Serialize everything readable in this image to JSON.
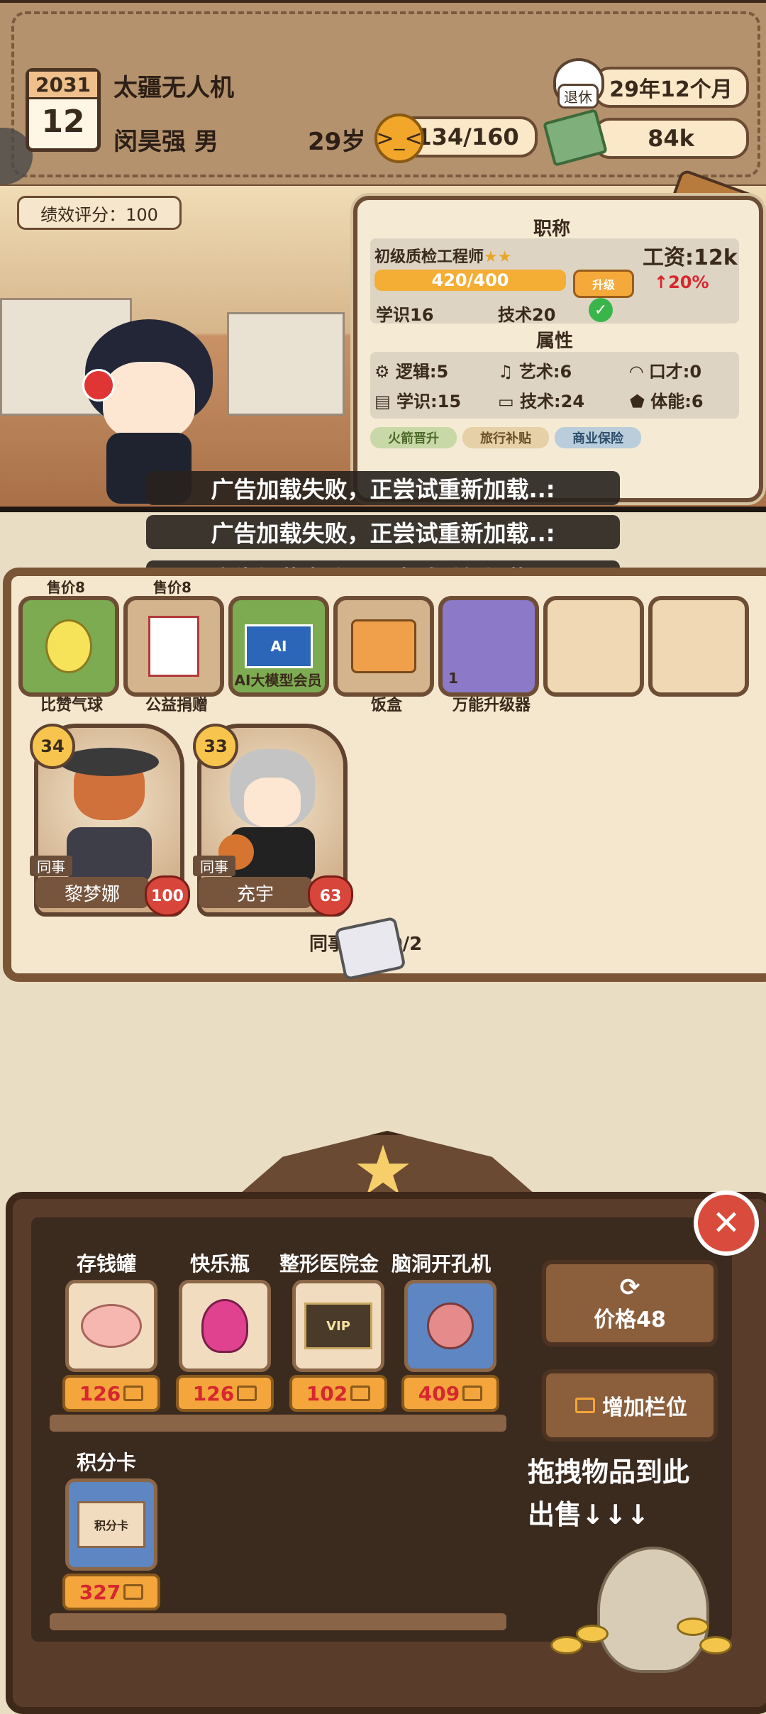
{
  "header": {
    "calendar_year": "2031",
    "calendar_month": "12",
    "company": "太疆无人机",
    "player_name": "闵昊强 男",
    "age": "29岁",
    "energy": "134/160",
    "retire_label": "退休",
    "retire_countdown": "29年12个月",
    "money": "84k"
  },
  "scene": {
    "performance_score": "绩效评分：100"
  },
  "job_panel": {
    "title_section": "职称",
    "job_title": "初级质检工程师",
    "job_stars": "★★",
    "salary": "工资:12k",
    "xp": "420/400",
    "upgrade_label": "升级",
    "boost": "↑20%",
    "req_knowledge": "学识16",
    "req_tech": "技术20",
    "attr_section": "属性",
    "attrs": [
      {
        "icon": "brain-icon",
        "label": "逻辑:5"
      },
      {
        "icon": "music-note-icon",
        "label": "艺术:6"
      },
      {
        "icon": "lips-icon",
        "label": "口才:0"
      },
      {
        "icon": "book-icon",
        "label": "学识:15"
      },
      {
        "icon": "monitor-icon",
        "label": "技术:24"
      },
      {
        "icon": "shield-icon",
        "label": "体能:6"
      }
    ],
    "chips": [
      "火箭晋升",
      "旅行补贴",
      "商业保险"
    ]
  },
  "toasts": [
    "广告加载失败，正尝试重新加载..:",
    "广告加载失败，正尝试重新加载..:",
    "广告加载失败，正尝试重新加载..:"
  ],
  "inventory": {
    "sell_price_1": "售价8",
    "sell_price_2": "售价8",
    "items": [
      {
        "name": "比赞气球",
        "icon": "balloon-icon",
        "color": "green"
      },
      {
        "name": "公益捐赠",
        "icon": "donation-box-icon",
        "color": "tan"
      },
      {
        "name": "AI大模型会员",
        "icon": "ai-card-icon",
        "color": "green"
      },
      {
        "name": "饭盒",
        "icon": "lunchbox-icon",
        "color": "tan"
      },
      {
        "name": "万能升级器",
        "icon": "upgrader-icon",
        "color": "purple",
        "count": "1"
      },
      {
        "name": "",
        "icon": "",
        "color": "empty"
      },
      {
        "name": "",
        "icon": "",
        "color": "empty"
      }
    ],
    "coworkers": [
      {
        "level": "34",
        "role": "同事",
        "name": "黎梦娜",
        "affinity": "100"
      },
      {
        "level": "33",
        "role": "同事",
        "name": "充宇",
        "affinity": "63"
      }
    ],
    "footer": "同事/家人0/2"
  },
  "shop": {
    "items": [
      {
        "name": "存钱罐",
        "icon": "piggy-bank-icon",
        "price": "126"
      },
      {
        "name": "快乐瓶",
        "icon": "potion-icon",
        "price": "126"
      },
      {
        "name": "整形医院金",
        "icon": "vip-card-icon",
        "price": "102"
      },
      {
        "name": "脑洞开孔机",
        "icon": "brain-machine-icon",
        "price": "409"
      },
      {
        "name": "积分卡",
        "icon": "points-card-icon",
        "price": "327"
      }
    ],
    "refresh_label": "价格48",
    "add_slot_label": "增加栏位",
    "sell_hint_line1": "拖拽物品到此",
    "sell_hint_line2": "出售↓↓↓"
  }
}
